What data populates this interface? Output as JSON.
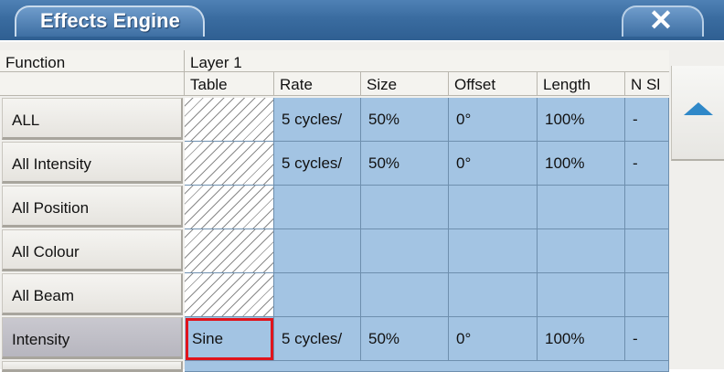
{
  "window": {
    "title": "Effects Engine",
    "close_glyph": "✕"
  },
  "header": {
    "function_label": "Function",
    "layer_label": "Layer 1",
    "columns": [
      "Table",
      "Rate",
      "Size",
      "Offset",
      "Length",
      "N Sl"
    ]
  },
  "rows": [
    {
      "function": "ALL",
      "table": "",
      "rate": "5 cycles/",
      "size": "50%",
      "offset": "0°",
      "length": "100%",
      "nshots": "-"
    },
    {
      "function": "All Intensity",
      "table": "",
      "rate": "5 cycles/",
      "size": "50%",
      "offset": "0°",
      "length": "100%",
      "nshots": "-"
    },
    {
      "function": "All Position",
      "table": "",
      "rate": "",
      "size": "",
      "offset": "",
      "length": "",
      "nshots": ""
    },
    {
      "function": "All Colour",
      "table": "",
      "rate": "",
      "size": "",
      "offset": "",
      "length": "",
      "nshots": ""
    },
    {
      "function": "All Beam",
      "table": "",
      "rate": "",
      "size": "",
      "offset": "",
      "length": "",
      "nshots": ""
    },
    {
      "function": "Intensity",
      "table": "Sine",
      "rate": "5 cycles/",
      "size": "50%",
      "offset": "0°",
      "length": "100%",
      "nshots": "-"
    }
  ],
  "selected_row": "Intensity",
  "colors": {
    "grid": "#a3c4e3",
    "highlight": "#e0141c",
    "titlebar": "#3a6ca0"
  },
  "icons": {
    "scroll_up": "arrow-up-icon",
    "close": "close-icon"
  }
}
